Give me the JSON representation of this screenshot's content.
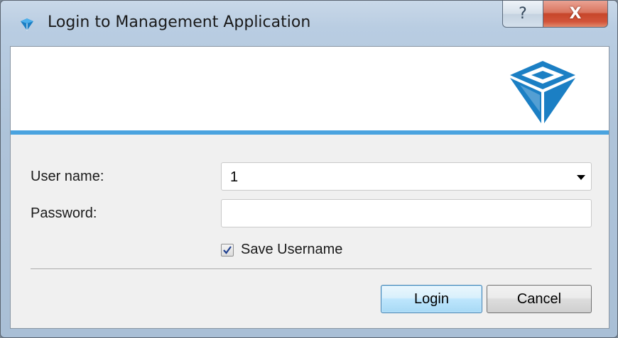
{
  "window": {
    "title": "Login to Management Application",
    "help_label": "?",
    "close_label": "X"
  },
  "form": {
    "username_label": "User name:",
    "username_value": "1",
    "password_label": "Password:",
    "password_value": "",
    "save_username_label": "Save Username",
    "save_username_checked": true
  },
  "actions": {
    "login_label": "Login",
    "cancel_label": "Cancel"
  },
  "icons": {
    "app_icon": "app-logo-icon",
    "help_icon": "help-icon",
    "close_icon": "close-icon",
    "dropdown_icon": "chevron-down-icon",
    "check_icon": "check-icon"
  },
  "colors": {
    "accent_line": "#4aa3df",
    "logo_blue": "#1b7fc4",
    "close_red": "#c7462a"
  }
}
